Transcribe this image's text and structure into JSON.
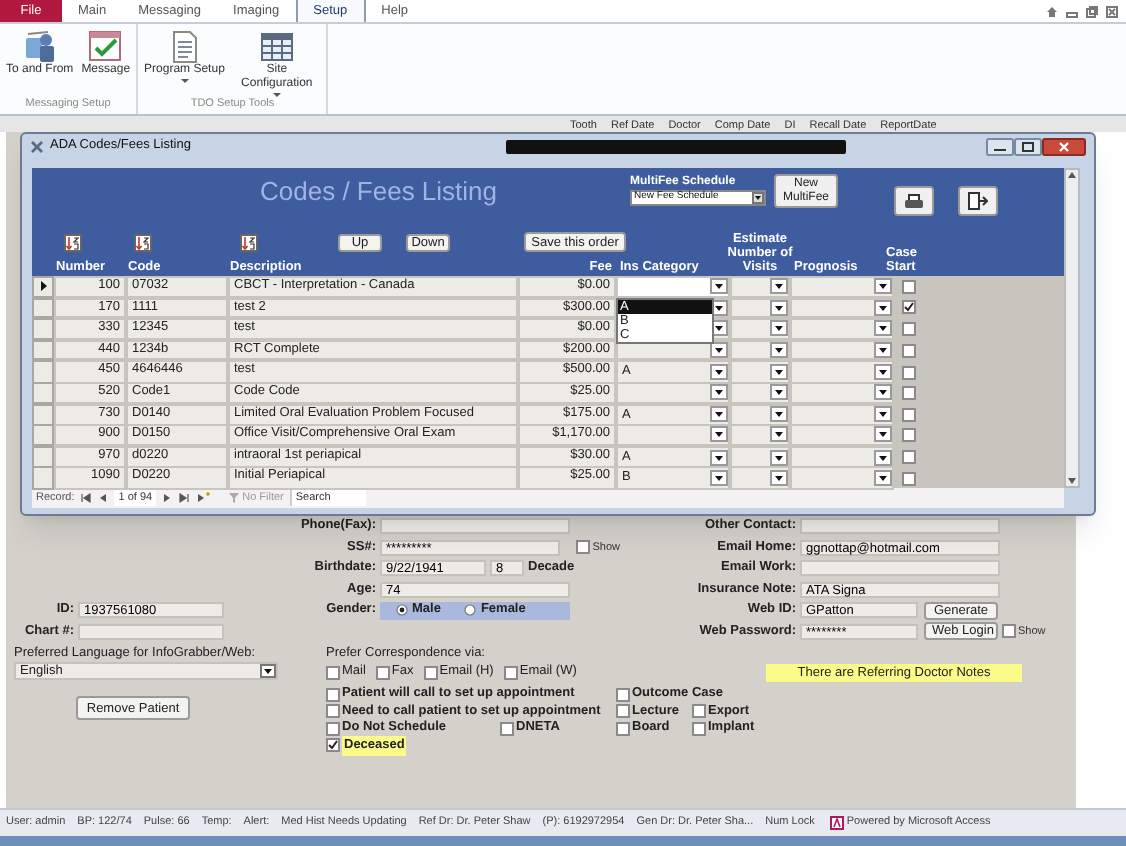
{
  "ribbon": {
    "file_menu": "File",
    "tabs": [
      {
        "label": "Main",
        "selected": false
      },
      {
        "label": "Messaging",
        "selected": false
      },
      {
        "label": "Imaging",
        "selected": false
      },
      {
        "label": "Setup",
        "selected": true
      },
      {
        "label": "Help",
        "selected": false
      }
    ],
    "groups": [
      {
        "label": "Messaging Setup",
        "buttons": [
          {
            "label": "To and From",
            "menu": false
          },
          {
            "label": "Message",
            "menu": false
          }
        ]
      },
      {
        "label": "TDO Setup Tools",
        "buttons": [
          {
            "label": "Program Setup",
            "menu": true
          },
          {
            "label": "Site Configuration",
            "menu": true
          }
        ]
      }
    ]
  },
  "background_columns": [
    "Tooth",
    "Ref Date",
    "Doctor",
    "Comp Date",
    "DI",
    "Recall Date",
    "ReportDate"
  ],
  "dialog": {
    "title": "ADA Codes/Fees Listing",
    "heading": "Codes / Fees Listing",
    "schedule_label": "MultiFee Schedule",
    "schedule_value": "New Fee Schedule",
    "new_multifee_button": "New MultiFee",
    "order_buttons": [
      "Up",
      "Down",
      "Save this order"
    ],
    "columns": [
      "Number",
      "Code",
      "Description",
      "Fee",
      "Ins Category",
      "Estimate Number of Visits",
      "Prognosis",
      "Case Start"
    ],
    "rows": [
      {
        "number": "100",
        "code": "07032",
        "description": "CBCT - Interpretation - Canada",
        "fee": "$0.00",
        "case_start": false,
        "current": true
      },
      {
        "number": "170",
        "code": "1111",
        "description": "test 2",
        "fee": "$300.00",
        "case_start": true,
        "current": false
      },
      {
        "number": "330",
        "code": "12345",
        "description": "test",
        "fee": "$0.00",
        "case_start": false,
        "current": false
      },
      {
        "number": "440",
        "code": "1234b",
        "description": "RCT Complete",
        "fee": "$200.00",
        "case_start": false,
        "current": false
      },
      {
        "number": "450",
        "code": "4646446",
        "description": "test",
        "fee": "$500.00",
        "ins_category": "A",
        "case_start": false,
        "current": false
      },
      {
        "number": "520",
        "code": "Code1",
        "description": "Code Code",
        "fee": "$25.00",
        "case_start": false,
        "current": false
      },
      {
        "number": "730",
        "code": "D0140",
        "description": "Limited Oral Evaluation Problem Focused",
        "fee": "$175.00",
        "ins_category": "A",
        "case_start": false,
        "current": false
      },
      {
        "number": "900",
        "code": "D0150",
        "description": "Office Visit/Comprehensive Oral Exam",
        "fee": "$1,170.00",
        "case_start": false,
        "current": false
      },
      {
        "number": "970",
        "code": "d0220",
        "description": "intraoral 1st periapical",
        "fee": "$30.00",
        "ins_category": "A",
        "case_start": false,
        "current": false
      },
      {
        "number": "1090",
        "code": "D0220",
        "description": "Initial Periapical",
        "fee": "$25.00",
        "ins_category": "B",
        "case_start": false,
        "current": false
      }
    ],
    "ins_dropdown": [
      {
        "label": "A",
        "selected": true
      },
      {
        "label": "B",
        "selected": false
      },
      {
        "label": "C",
        "selected": false
      }
    ],
    "navigator": {
      "label": "Record:",
      "position": "1 of 94",
      "filter": "No Filter",
      "search": "Search"
    }
  },
  "patient": {
    "left": [
      {
        "label": "ID:",
        "value": "1937561080"
      },
      {
        "label": "Chart #:"
      }
    ],
    "middle": [
      {
        "kind": "field",
        "label": "Phone(Fax):"
      },
      {
        "kind": "field",
        "label": "SS#:",
        "value": "*********",
        "show": {
          "label": "Show",
          "checked": false
        }
      },
      {
        "kind": "birthdate",
        "label": "Birthdate:",
        "value": "9/22/1941",
        "decade": "8",
        "decade_label": "Decade"
      },
      {
        "kind": "field",
        "label": "Age:",
        "value": "74"
      },
      {
        "kind": "radio",
        "label": "Gender:",
        "options": [
          {
            "label": "Male",
            "selected": true
          },
          {
            "label": "Female",
            "selected": false
          }
        ]
      }
    ],
    "right": [
      {
        "label": "Other Contact:"
      },
      {
        "label": "Email Home:",
        "value": "ggnottap@hotmail.com"
      },
      {
        "label": "Email Work:"
      },
      {
        "label": "Insurance Note:",
        "value": "ATA Signa"
      },
      {
        "label": "Web ID:",
        "value": "GPatton",
        "button": "Generate"
      },
      {
        "label": "Web Password:",
        "value": "********",
        "button": "Web Login",
        "show": {
          "label": "Show",
          "checked": false
        }
      }
    ]
  },
  "language": {
    "label": "Preferred Language for InfoGrabber/Web:",
    "value": "English"
  },
  "remove_button": "Remove Patient",
  "correspondence": {
    "label": "Prefer Correspondence via:",
    "options": [
      {
        "label": "Mail",
        "checked": false
      },
      {
        "label": "Fax",
        "checked": false
      },
      {
        "label": "Email (H)",
        "checked": false
      },
      {
        "label": "Email (W)",
        "checked": false
      }
    ]
  },
  "flags": [
    {
      "label": "Patient will call to set up appointment",
      "checked": false,
      "highlighted": false
    },
    {
      "label": "Outcome Case",
      "checked": false,
      "highlighted": false
    },
    {
      "label": "Need to call patient to set up appointment",
      "checked": false,
      "highlighted": false
    },
    {
      "label": "Lecture",
      "checked": false,
      "highlighted": false
    },
    {
      "label": "Export",
      "checked": false,
      "highlighted": false
    },
    {
      "label": "Do Not Schedule",
      "checked": false,
      "highlighted": false
    },
    {
      "label": "DNETA",
      "checked": false,
      "highlighted": false
    },
    {
      "label": "Board",
      "checked": false,
      "highlighted": false
    },
    {
      "label": "Implant",
      "checked": false,
      "highlighted": false
    },
    {
      "label": "Deceased",
      "checked": true,
      "highlighted": true
    }
  ],
  "notes_banner": "There are Referring Doctor Notes",
  "status_bar": [
    "User: admin",
    "BP: 122/74",
    "Pulse: 66",
    "Temp:",
    "Alert:",
    "Med Hist Needs Updating",
    "Ref Dr: Dr. Peter Shaw",
    "(P): 6192972954",
    "Gen Dr: Dr. Peter Sha...",
    "Num Lock",
    "Powered by Microsoft Access"
  ]
}
